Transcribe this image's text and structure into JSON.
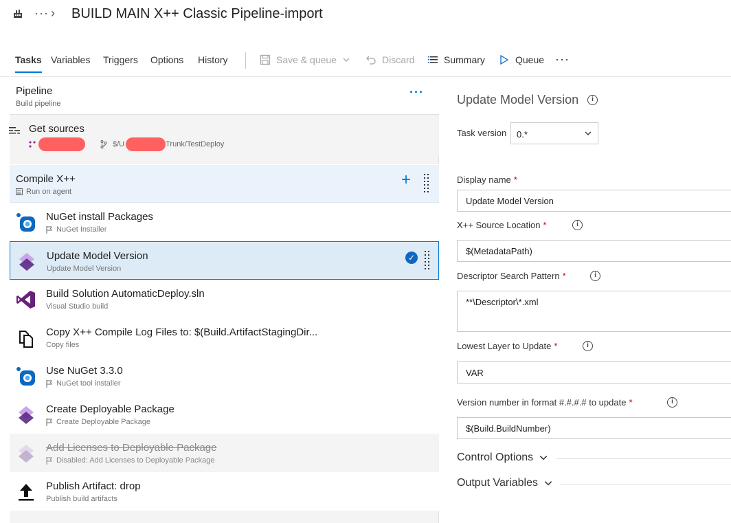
{
  "header": {
    "title": "BUILD MAIN X++ Classic Pipeline-import",
    "ellipsis": "···",
    "chevron": "›"
  },
  "tabs": [
    {
      "label": "Tasks",
      "active": true
    },
    {
      "label": "Variables"
    },
    {
      "label": "Triggers"
    },
    {
      "label": "Options"
    },
    {
      "label": "History"
    }
  ],
  "toolbar": {
    "save_queue": "Save & queue",
    "discard": "Discard",
    "summary": "Summary",
    "queue": "Queue",
    "more": "···"
  },
  "pipeline": {
    "title": "Pipeline",
    "subtitle": "Build pipeline",
    "more": "···"
  },
  "sources": {
    "title": "Get sources",
    "path_prefix": "$/U",
    "path_suffix": "Trunk/TestDeploy"
  },
  "phase": {
    "title": "Compile X++",
    "subtitle": "Run on agent",
    "add": "+"
  },
  "tasks": [
    {
      "title": "NuGet install Packages",
      "subtitle": "NuGet Installer",
      "icon": "nuget-icon"
    },
    {
      "title": "Update Model Version",
      "subtitle": "Update Model Version",
      "icon": "dynamics-icon",
      "selected": true
    },
    {
      "title": "Build Solution AutomaticDeploy.sln",
      "subtitle": "Visual Studio build",
      "icon": "visual-studio-icon"
    },
    {
      "title": "Copy X++ Compile Log Files to: $(Build.ArtifactStagingDir...",
      "subtitle": "Copy files",
      "icon": "copy-files-icon"
    },
    {
      "title": "Use NuGet 3.3.0",
      "subtitle": "NuGet tool installer",
      "icon": "nuget-icon"
    },
    {
      "title": "Create Deployable Package",
      "subtitle": "Create Deployable Package",
      "icon": "dynamics-icon"
    },
    {
      "title": "Add Licenses to Deployable Package",
      "subtitle": "Disabled: Add Licenses to Deployable Package",
      "icon": "dynamics-icon",
      "disabled": true
    },
    {
      "title": "Publish Artifact: drop",
      "subtitle": "Publish build artifacts",
      "icon": "publish-icon"
    }
  ],
  "details": {
    "title": "Update Model Version",
    "task_version_label": "Task version",
    "task_version_value": "0.*",
    "display_name_label": "Display name",
    "display_name_value": "Update Model Version",
    "source_location_label": "X++ Source Location",
    "source_location_value": "$(MetadataPath)",
    "descriptor_label": "Descriptor Search Pattern",
    "descriptor_value": "**\\Descriptor\\*.xml",
    "layer_label": "Lowest Layer to Update",
    "layer_value": "VAR",
    "version_label": "Version number in format #.#.#.# to update",
    "version_value": "$(Build.BuildNumber)",
    "control_options": "Control Options",
    "output_variables": "Output Variables",
    "required_mark": "*",
    "info_glyph": "i"
  },
  "colors": {
    "accent": "#0078d4",
    "selected_bg": "#dcebf6",
    "phase_bg": "#eaf3fb",
    "redaction": "#ff6060"
  }
}
